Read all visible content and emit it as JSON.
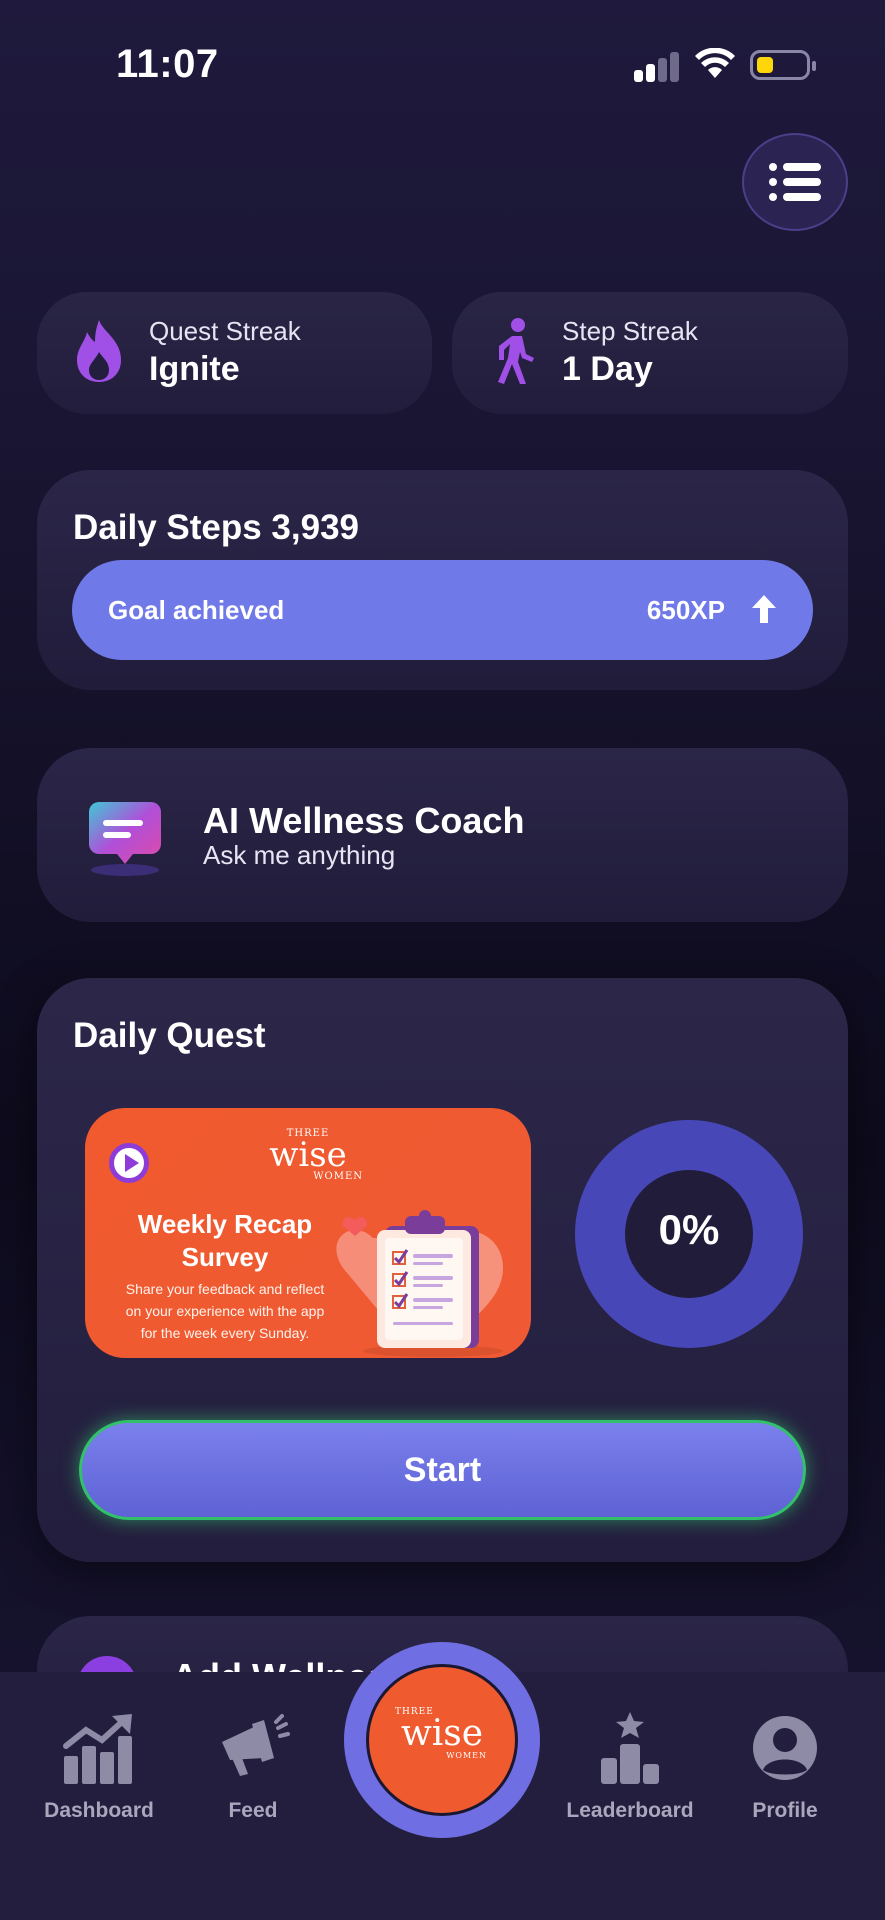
{
  "status_bar": {
    "time": "11:07"
  },
  "streaks": {
    "quest": {
      "label": "Quest Streak",
      "value": "Ignite",
      "icon": "flame-icon"
    },
    "step": {
      "label": "Step Streak",
      "value": "1 Day",
      "icon": "walking-icon"
    }
  },
  "steps": {
    "title": "Daily Steps 3,939",
    "goal_text": "Goal achieved",
    "xp": "650XP"
  },
  "coach": {
    "title": "AI Wellness Coach",
    "subtitle": "Ask me anything"
  },
  "quest": {
    "title": "Daily Quest",
    "survey": {
      "brand_top": "THREE",
      "brand_main": "wise",
      "brand_bottom": "WOMEN",
      "heading_line1": "Weekly Recap",
      "heading_line2": "Survey",
      "desc_line1": "Share your feedback and reflect",
      "desc_line2": "on your experience with the app",
      "desc_line3": "for the week every Sunday."
    },
    "progress_label": "0%",
    "progress": 0,
    "start_label": "Start"
  },
  "next_card": {
    "title": "Add Wellness"
  },
  "nav": {
    "dashboard": "Dashboard",
    "feed": "Feed",
    "leaderboard": "Leaderboard",
    "profile": "Profile",
    "center_brand_top": "THREE",
    "center_brand_main": "wise",
    "center_brand_bottom": "WOMEN"
  },
  "colors": {
    "accent": "#7079e8",
    "brand_orange": "#ef5a2f",
    "purple": "#8e3cd8",
    "success_glow": "#33c06a"
  }
}
